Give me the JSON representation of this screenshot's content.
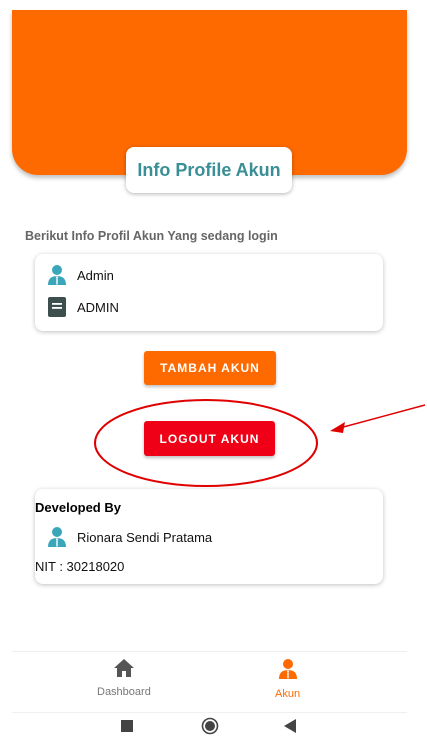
{
  "header": {
    "title": "Info Profile Akun"
  },
  "subtitle": "Berikut Info Profil Akun Yang sedang login",
  "user_card": {
    "name": "Admin",
    "role": "ADMIN"
  },
  "buttons": {
    "tambah": "TAMBAH AKUN",
    "logout": "LOGOUT AKUN"
  },
  "developer": {
    "title": "Developed By",
    "name": "Rionara Sendi Pratama",
    "nit": "NIT : 30218020"
  },
  "bottom_nav": [
    {
      "label": "Dashboard",
      "icon": "home-icon",
      "active": false
    },
    {
      "label": "Akun",
      "icon": "user-icon",
      "active": true
    }
  ],
  "system_nav": {
    "icons": [
      "recents-square-icon",
      "home-circle-icon",
      "back-triangle-icon"
    ]
  },
  "colors": {
    "primary": "#ff6a00",
    "accent_text": "#3a8f96",
    "logout": "#f00016",
    "annotation": "#e00000"
  }
}
